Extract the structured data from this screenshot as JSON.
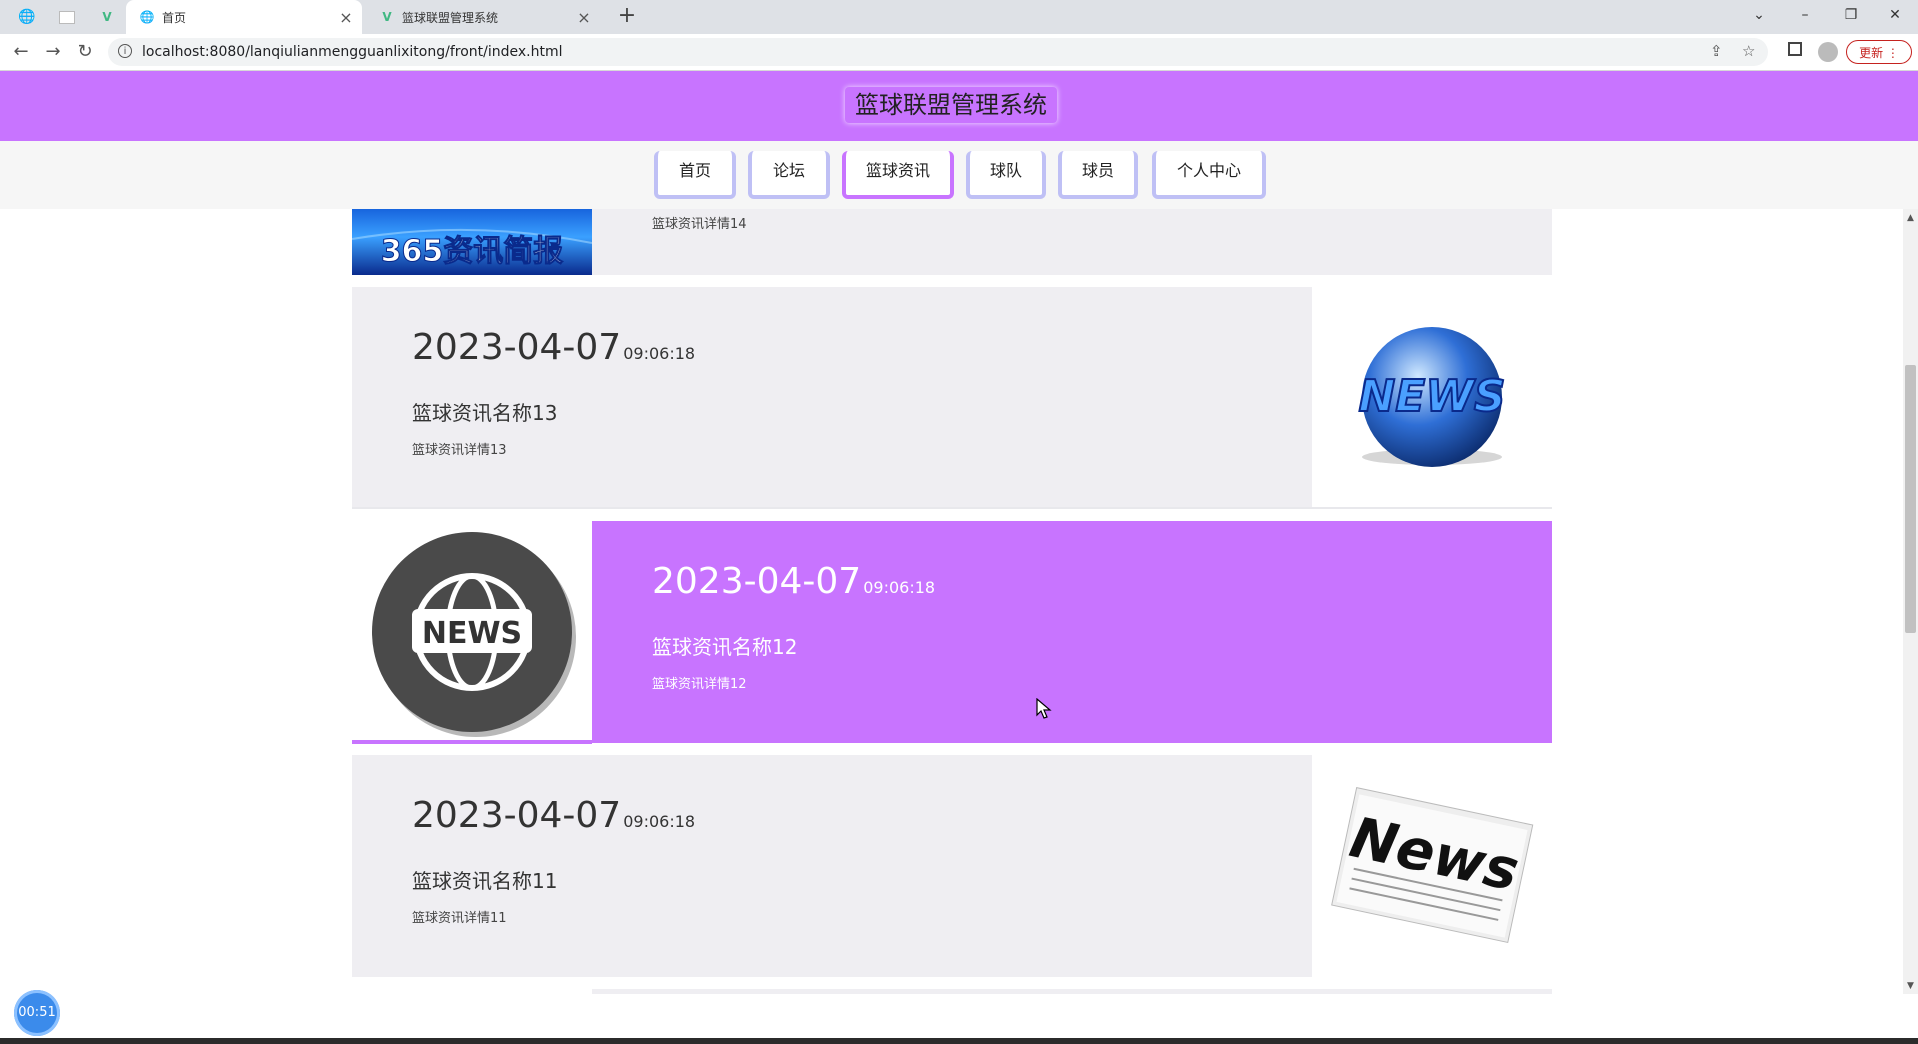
{
  "browser": {
    "tabs": [
      {
        "title": "",
        "icon": "globe-icon"
      },
      {
        "title": "",
        "icon": "blank-page-icon"
      },
      {
        "title": "",
        "icon": "vue-icon"
      },
      {
        "title": "首页",
        "icon": "globe-icon",
        "active": true
      },
      {
        "title": "篮球联盟管理系统",
        "icon": "vue-icon"
      }
    ],
    "url": "localhost:8080/lanqiulianmengguanlixitong/front/index.html",
    "update_label": "更新"
  },
  "site": {
    "title": "篮球联盟管理系统",
    "nav": [
      "首页",
      "论坛",
      "篮球资讯",
      "球队",
      "球员",
      "个人中心"
    ],
    "active_nav": "篮球资讯"
  },
  "news": [
    {
      "detail": "篮球资讯详情14",
      "image": "365资讯简报"
    },
    {
      "date": "2023-04-07",
      "time": "09:06:18",
      "name": "篮球资讯名称13",
      "detail": "篮球资讯详情13",
      "image": "NEWS"
    },
    {
      "date": "2023-04-07",
      "time": "09:06:18",
      "name": "篮球资讯名称12",
      "detail": "篮球资讯详情12",
      "image": "NEWS"
    },
    {
      "date": "2023-04-07",
      "time": "09:06:18",
      "name": "篮球资讯名称11",
      "detail": "篮球资讯详情11",
      "image": "News"
    }
  ],
  "timer": "00:51",
  "colors": {
    "accent": "#c874ff",
    "nav_border": "#bfc0f5",
    "card_bg": "#efeef2"
  }
}
